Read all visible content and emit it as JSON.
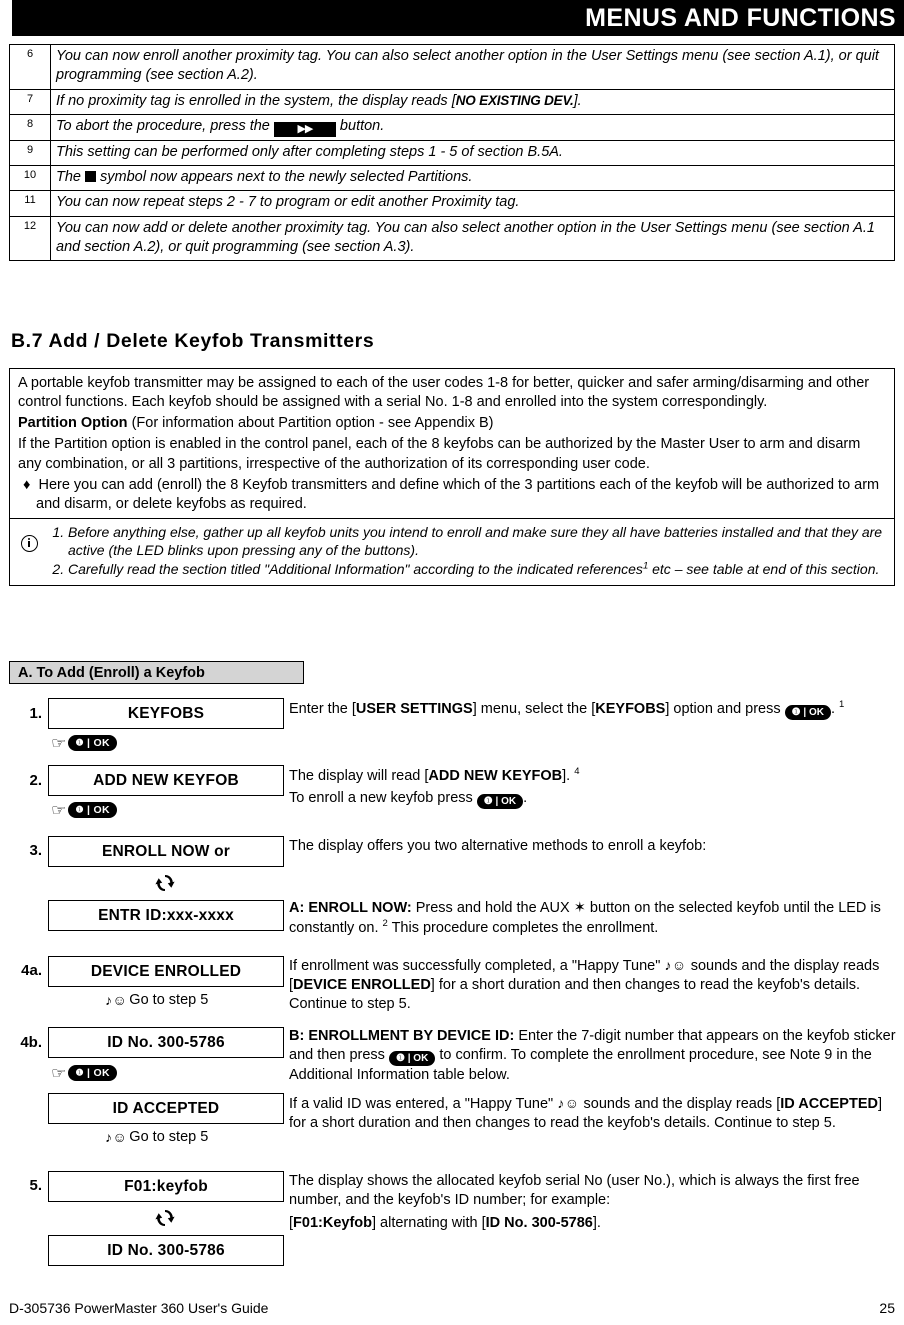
{
  "header": {
    "banner_title": "MENUS AND FUNCTIONS"
  },
  "notes_table": {
    "rows": [
      {
        "num": "6",
        "text_a": "You can now enroll another proximity tag. You can also select another option in the User Settings menu (see section A.1), or quit programming (see section A.2)."
      },
      {
        "num": "7",
        "text_a": "If no proximity tag is enrolled in the system, the display reads [",
        "emphasis": "NO EXISTING DEV.",
        "text_b": "]."
      },
      {
        "num": "8",
        "text_a": "To abort the procedure, press the ",
        "icon": "fast-forward-key",
        "text_b": " button."
      },
      {
        "num": "9",
        "text_a": "This setting can be performed only after completing steps 1 - 5 of section B.5A."
      },
      {
        "num": "10",
        "text_a": "The ",
        "icon": "black-square-symbol",
        "text_b": " symbol now appears next to the newly selected Partitions."
      },
      {
        "num": "11",
        "text_a": "You can now repeat steps 2 - 7 to program or edit another Proximity tag."
      },
      {
        "num": "12",
        "text_a": "You can now add or delete another proximity tag. You can also select another option in the User Settings menu (see section A.1 and section A.2), or quit programming (see section A.3)."
      }
    ]
  },
  "section": {
    "heading": "B.7 Add / Delete Keyfob Transmitters"
  },
  "description": {
    "para1": "A portable keyfob transmitter may be assigned to each of the user codes 1-8 for better, quicker and safer arming/disarming and other control functions. Each keyfob should be assigned with a serial No. 1-8 and enrolled into the system correspondingly.",
    "partition_label": "Partition Option",
    "partition_rest": " (For information about Partition option - see Appendix B)",
    "para2": "If the Partition option is enabled in the control panel, each of the 8 keyfobs can be authorized by the Master User to arm and disarm any combination, or all 3 partitions, irrespective of the authorization of its corresponding user code.",
    "bullet_symbol": "♦",
    "bullet1": "Here you can add (enroll) the 8 Keyfob transmitters and define which of the 3 partitions each of the keyfob will be authorized to arm and disarm, or delete keyfobs as required.",
    "note1": "Before anything else, gather up all keyfob units you intend to enroll and make sure they all have batteries installed and that they are active (the LED blinks upon pressing any of the buttons).",
    "note2_a": "Carefully read the section titled \"Additional Information\" according to the indicated references",
    "note2_ref": "1",
    "note2_b": " etc – see table at end of this section."
  },
  "subsection": {
    "label": "A. To Add (Enroll) a Keyfob"
  },
  "steps": {
    "step1": {
      "num": "1.",
      "lcd": "KEYFOBS",
      "press_icon": "hand-pointer-icon",
      "ok_key": "OK",
      "text_a": "Enter the [",
      "bold_1": "USER SETTINGS",
      "text_b": "] menu, select the [",
      "bold_2": "KEYFOBS",
      "text_c": "] option and press ",
      "text_d": ".",
      "ref": "1"
    },
    "step2": {
      "num": "2.",
      "lcd": "ADD NEW KEYFOB",
      "ok_key": "OK",
      "text_a": "The display will read [",
      "bold_1": "ADD NEW KEYFOB",
      "text_b": "].",
      "ref": "4",
      "text_c": "To enroll a new keyfob press ",
      "text_d": "."
    },
    "step3": {
      "num": "3.",
      "lcd_a": "ENROLL NOW or",
      "rot_icon": "alternating-display-icon",
      "lcd_b": "ENTR ID:xxx-xxxx",
      "text_top": "The display offers you two alternative methods to enroll a keyfob:",
      "bold_1": "A: ENROLL NOW:",
      "text_a": " Press and hold the AUX ✶ button on the selected keyfob until the LED is constantly on. ",
      "ref": "2",
      "text_b": " This procedure completes the enrollment."
    },
    "step4a": {
      "num": "4a.",
      "lcd": "DEVICE ENROLLED",
      "tune_icon": "happy-tune-icon",
      "goto": "Go to step 5",
      "text_a": "If enrollment was successfully completed, a \"Happy Tune\" ",
      "text_b": " sounds and the display reads [",
      "bold_1": "DEVICE ENROLLED",
      "text_c": "] for a short duration and then changes to read the keyfob's details. Continue to step 5."
    },
    "step4b": {
      "num": "4b.",
      "lcd_a": "ID No. 300-5786",
      "ok_key": "OK",
      "lcd_b": "ID ACCEPTED",
      "tune_icon": "happy-tune-icon",
      "goto": "Go to step 5",
      "bold_1": "B: ENROLLMENT BY DEVICE ID:",
      "text_a": " Enter the 7-digit number that appears on the keyfob sticker and then press ",
      "text_b": " to confirm. To complete the enrollment procedure, see Note 9 in the Additional Information table below.",
      "text_c": "If a valid ID was entered, a \"Happy Tune\" ",
      "text_d": " sounds and the display reads [",
      "bold_2": "ID ACCEPTED",
      "text_e": "] for a short duration and then changes to read the keyfob's details. Continue to step 5."
    },
    "step5": {
      "num": "5.",
      "lcd_a": "F01:keyfob",
      "rot_icon": "alternating-display-icon",
      "lcd_b": "ID No. 300-5786",
      "text_a": "The display shows the allocated keyfob serial No (user No.), which is always the first free number, and the keyfob's ID number; for example:",
      "text_b": "[",
      "bold_1": "F01:Keyfob",
      "text_c": "] alternating with [",
      "bold_2": "ID No. 300-5786",
      "text_d": "]."
    }
  },
  "footer": {
    "left": "D-305736 PowerMaster 360 User's Guide",
    "right": "25"
  }
}
